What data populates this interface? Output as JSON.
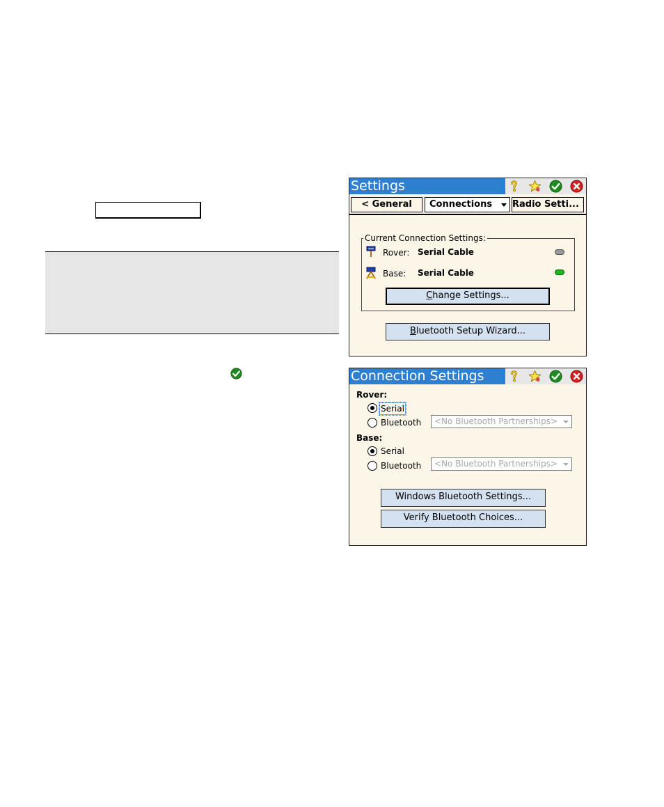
{
  "settings_screen": {
    "title": "Settings",
    "tabs": {
      "prev": "< General",
      "current": "Connections",
      "next": "Radio Setti... >"
    },
    "group_legend": "Current Connection Settings:",
    "rover": {
      "label": "Rover:",
      "value": "Serial Cable",
      "status_color": "#9a9a9a"
    },
    "base": {
      "label": "Base:",
      "value": "Serial Cable",
      "status_color": "#22b522"
    },
    "change_button": {
      "mnemonic": "C",
      "rest": "hange  Settings..."
    },
    "bluetooth_wizard_button": {
      "mnemonic": "B",
      "rest": "luetooth Setup Wizard..."
    }
  },
  "connection_screen": {
    "title": "Connection Settings",
    "rover": {
      "heading": "Rover:",
      "serial_label": "Serial",
      "bluetooth_label": "Bluetooth",
      "bluetooth_dropdown": "<No Bluetooth Partnerships>",
      "selected": "Serial"
    },
    "base": {
      "heading": "Base:",
      "serial_label": "Serial",
      "bluetooth_label": "Bluetooth",
      "bluetooth_dropdown": "<No Bluetooth Partnerships>",
      "selected": "Serial"
    },
    "windows_bt_button": "Windows Bluetooth Settings...",
    "verify_bt_button": "Verify Bluetooth Choices..."
  },
  "icons": {
    "help": "help-icon",
    "favorite": "favorite-star-icon",
    "ok": "ok-check-icon",
    "close": "close-x-icon",
    "rover": "rover-antenna-icon",
    "base": "base-antenna-icon"
  },
  "colors": {
    "titlebar": "#2e7fd0",
    "screen_bg": "#fbf6e8",
    "button_bg": "#d3e1f0",
    "ok_green": "#1f8a1f",
    "close_red": "#d42020"
  }
}
